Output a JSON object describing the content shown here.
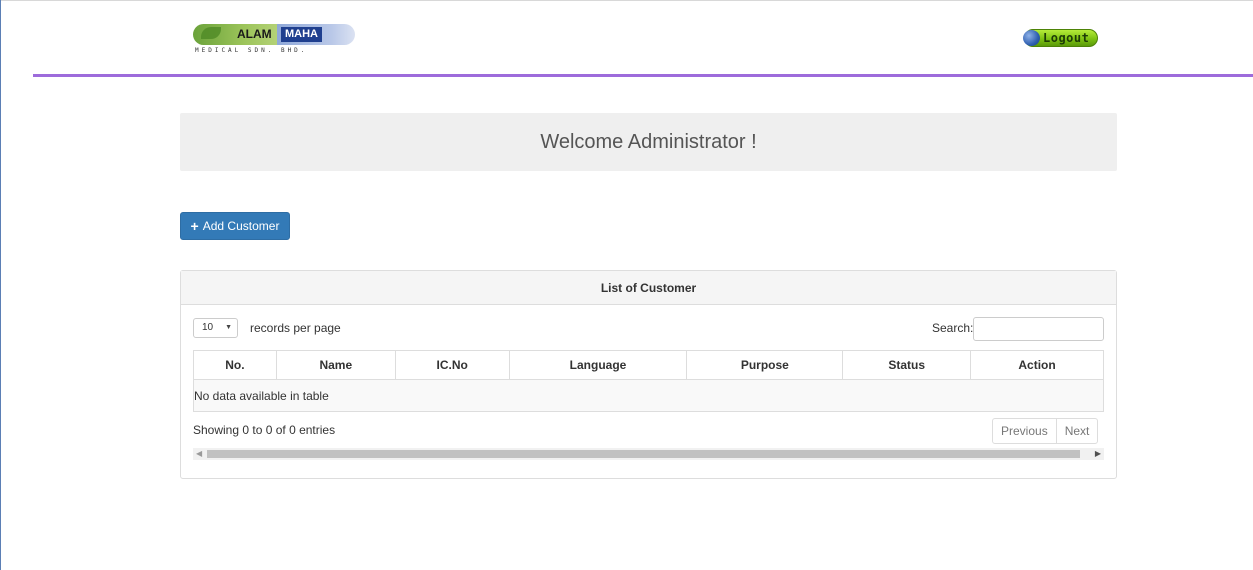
{
  "header": {
    "logo": {
      "word1": "ALAM",
      "word2": "MAHA",
      "subtitle": "MEDICAL SDN. BHD."
    },
    "logout_label": "Logout"
  },
  "welcome_text": "Welcome Administrator !",
  "add_button_label": "Add Customer",
  "panel": {
    "title": "List of Customer",
    "length": {
      "value": "10",
      "label": "records per page"
    },
    "search": {
      "label": "Search:",
      "value": ""
    },
    "columns": [
      "No.",
      "Name",
      "IC.No",
      "Language",
      "Purpose",
      "Status",
      "Action"
    ],
    "empty_message": "No data available in table",
    "info": "Showing 0 to 0 of 0 entries",
    "pagination": {
      "previous": "Previous",
      "next": "Next"
    }
  },
  "colors": {
    "accent_rule": "#9d6bdb",
    "primary_button": "#337ab7",
    "logout_green": "#7ec313"
  }
}
